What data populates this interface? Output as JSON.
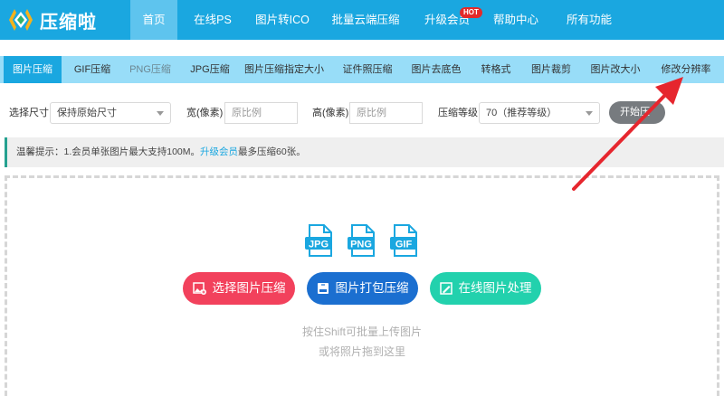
{
  "header": {
    "logo_text": "压缩啦",
    "nav": [
      {
        "label": "首页",
        "active": true
      },
      {
        "label": "在线PS"
      },
      {
        "label": "图片转ICO"
      },
      {
        "label": "批量云端压缩"
      },
      {
        "label": "升级会员",
        "badge": "HOT"
      },
      {
        "label": "帮助中心"
      },
      {
        "label": "所有功能"
      }
    ],
    "colors": {
      "bar": "#1aa7e0",
      "active": "#5ec4ee",
      "badge": "#e42a2a"
    }
  },
  "tabs": [
    {
      "label": "图片压缩",
      "active": true
    },
    {
      "label": "GIF压缩"
    },
    {
      "label": "PNG压缩"
    },
    {
      "label": "JPG压缩"
    },
    {
      "label": "图片压缩指定大小"
    },
    {
      "label": "证件照压缩"
    },
    {
      "label": "图片去底色"
    },
    {
      "label": "转格式"
    },
    {
      "label": "图片裁剪"
    },
    {
      "label": "图片改大小"
    },
    {
      "label": "修改分辨率"
    }
  ],
  "options": {
    "size_label": "选择尺寸",
    "size_value": "保持原始尺寸",
    "width_label": "宽(像素)",
    "width_placeholder": "原比例",
    "height_label": "高(像素)",
    "height_placeholder": "原比例",
    "level_label": "压缩等级",
    "level_value": "70（推荐等级）",
    "start_label": "开始压"
  },
  "tip": {
    "text": "温馨提示：1.会员单张图片最大支持100M。",
    "link": "升级会员",
    "suffix": "最多压缩60张。"
  },
  "upload": {
    "file_types": [
      "JPG",
      "PNG",
      "GIF"
    ],
    "buttons": [
      {
        "label": "选择图片压缩",
        "icon": "image-add-icon",
        "color": "#f2415c"
      },
      {
        "label": "图片打包压缩",
        "icon": "zip-icon",
        "color": "#1b6fd0"
      },
      {
        "label": "在线图片处理",
        "icon": "image-edit-icon",
        "color": "#22d1ad"
      }
    ],
    "hint_line1": "按住Shift可批量上传图片",
    "hint_line2": "或将照片拖到这里"
  },
  "annotation": {
    "icon": "red-arrow-icon",
    "color": "#e6262e"
  }
}
